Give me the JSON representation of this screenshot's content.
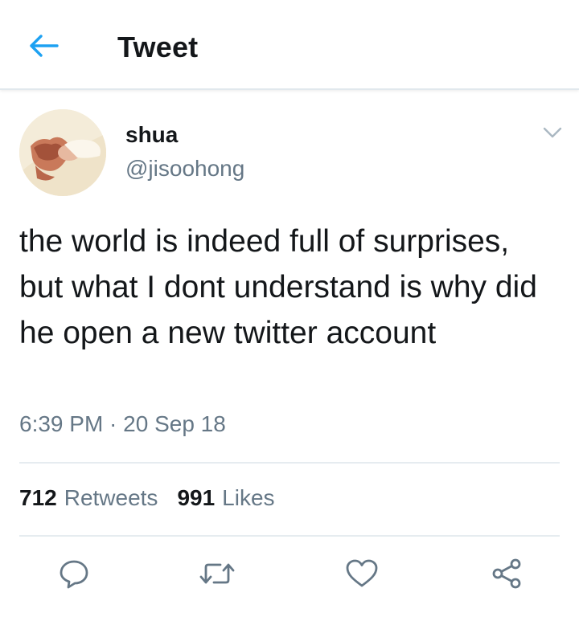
{
  "header": {
    "title": "Tweet",
    "back_icon": "arrow-left-icon",
    "accent_color": "#1da1f2"
  },
  "tweet": {
    "author": {
      "display_name": "shua",
      "handle": "@jisoohong"
    },
    "text": "the world is indeed full of surprises, but what I dont understand is why did he open a new twitter account",
    "timestamp": "6:39 PM · 20 Sep 18",
    "stats": {
      "retweets_count": "712",
      "retweets_label": "Retweets",
      "likes_count": "991",
      "likes_label": "Likes"
    },
    "actions": [
      {
        "name": "reply",
        "icon": "reply-bubble-icon"
      },
      {
        "name": "retweet",
        "icon": "retweet-icon"
      },
      {
        "name": "like",
        "icon": "heart-icon"
      },
      {
        "name": "share",
        "icon": "share-icon"
      }
    ]
  },
  "colors": {
    "text_primary": "#14171a",
    "text_secondary": "#657786",
    "divider": "#e6ecf0"
  }
}
